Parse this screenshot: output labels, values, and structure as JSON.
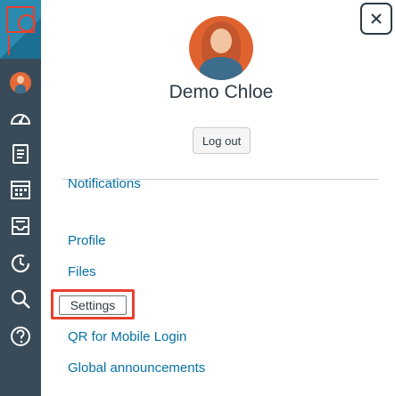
{
  "profile": {
    "user_name": "Demo Chloe",
    "logout_label": "Log out"
  },
  "menu": {
    "items": [
      {
        "label": "Notifications"
      },
      {
        "label": "Profile"
      },
      {
        "label": "Files"
      },
      {
        "label": "Settings"
      },
      {
        "label": "QR for Mobile Login"
      },
      {
        "label": "Global announcements"
      }
    ]
  },
  "rail": {
    "icons": [
      "canvas-logo",
      "account-avatar",
      "dashboard-icon",
      "courses-icon",
      "calendar-icon",
      "inbox-icon",
      "history-icon",
      "search-icon",
      "help-icon"
    ]
  },
  "colors": {
    "rail_background": "#394b58",
    "link": "#0770a3",
    "highlight_border": "#e8402f",
    "text": "#2d3b45"
  }
}
